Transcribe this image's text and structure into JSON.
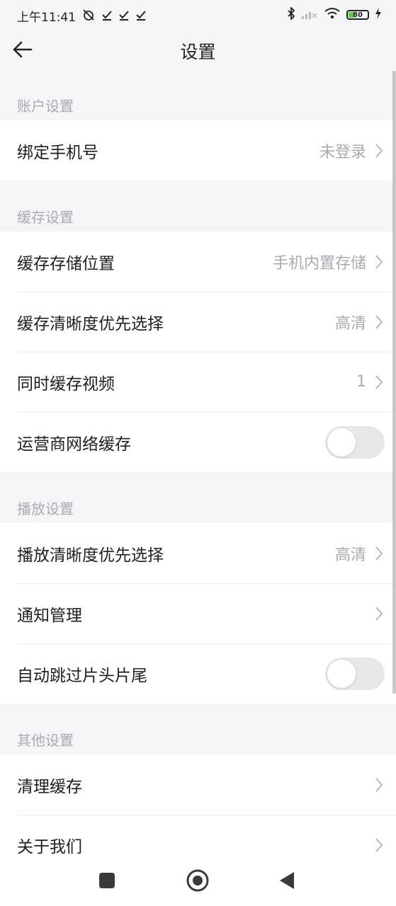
{
  "status_bar": {
    "time": "上午11:41",
    "battery": "80",
    "icons": [
      "alarm-off-icon",
      "check-icon",
      "check-icon",
      "check-icon",
      "bluetooth-icon",
      "signal-icon",
      "wifi-icon",
      "battery-icon",
      "charging-icon"
    ]
  },
  "header": {
    "title": "设置"
  },
  "sections": [
    {
      "title": "账户设置",
      "rows": [
        {
          "label": "绑定手机号",
          "value": "未登录",
          "type": "link"
        }
      ]
    },
    {
      "title": "缓存设置",
      "rows": [
        {
          "label": "缓存存储位置",
          "value": "手机内置存储",
          "type": "link"
        },
        {
          "label": "缓存清晰度优先选择",
          "value": "高清",
          "type": "link"
        },
        {
          "label": "同时缓存视频",
          "value": "1",
          "type": "link"
        },
        {
          "label": "运营商网络缓存",
          "type": "toggle",
          "on": false
        }
      ]
    },
    {
      "title": "播放设置",
      "rows": [
        {
          "label": "播放清晰度优先选择",
          "value": "高清",
          "type": "link"
        },
        {
          "label": "通知管理",
          "value": "",
          "type": "link"
        },
        {
          "label": "自动跳过片头片尾",
          "type": "toggle",
          "on": false
        }
      ]
    },
    {
      "title": "其他设置",
      "rows": [
        {
          "label": "清理缓存",
          "value": "",
          "type": "link"
        },
        {
          "label": "关于我们",
          "value": "",
          "type": "link"
        }
      ]
    }
  ],
  "colors": {
    "background": "#f4f5f7",
    "secondary_text": "#a9abb0",
    "toggle_off": "#e6e7e9"
  }
}
